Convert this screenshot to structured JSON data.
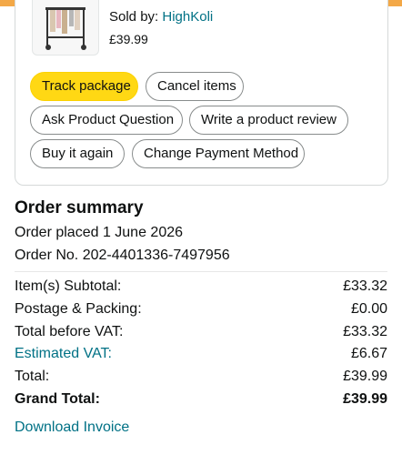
{
  "item": {
    "sold_by_label": "Sold by:",
    "seller": "HighKoli",
    "price": "£39.99"
  },
  "actions": {
    "track_package": "Track package",
    "cancel_items": "Cancel items",
    "ask_question": "Ask Product Question",
    "write_review": "Write a product review",
    "buy_again": "Buy it again",
    "change_payment": "Change Payment Method"
  },
  "summary": {
    "title": "Order summary",
    "order_placed": "Order placed 1 June 2026",
    "order_no": "Order No. 202-4401336-7497956",
    "rows": [
      {
        "label": "Item(s) Subtotal:",
        "value": "£33.32"
      },
      {
        "label": "Postage & Packing:",
        "value": "£0.00"
      },
      {
        "label": "Total before VAT:",
        "value": "£33.32"
      },
      {
        "label": "Estimated VAT:",
        "value": "£6.67"
      },
      {
        "label": "Total:",
        "value": "£39.99"
      },
      {
        "label": "Grand Total:",
        "value": "£39.99"
      }
    ],
    "download_invoice": "Download Invoice"
  },
  "colors": {
    "accent_bar": "#f3a847",
    "primary_button": "#ffd814",
    "link": "#007185"
  }
}
